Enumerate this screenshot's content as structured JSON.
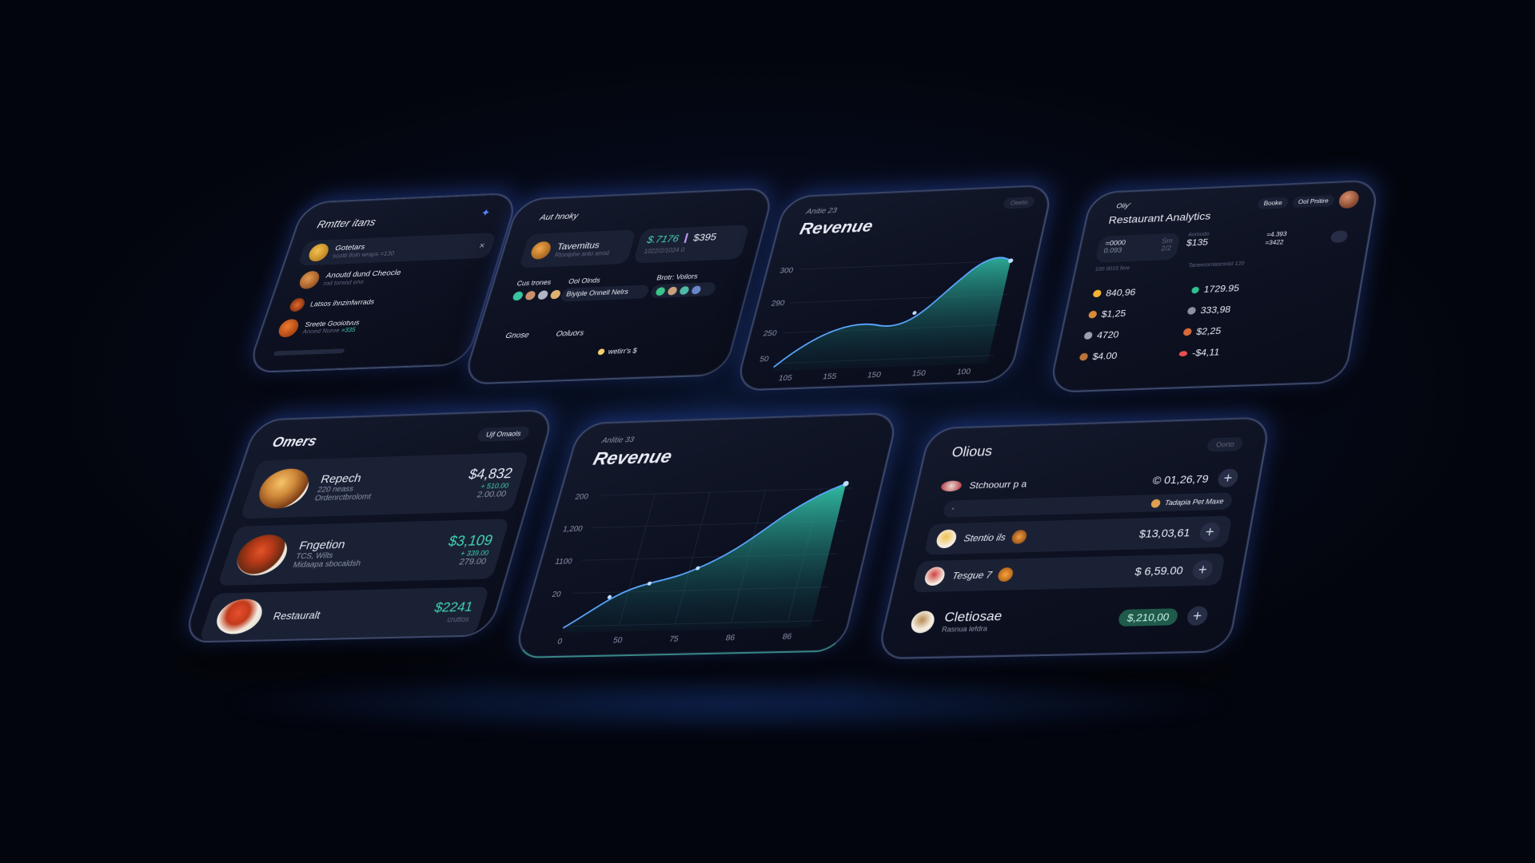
{
  "card1": {
    "title": "Rmtter itans",
    "items": [
      {
        "name": "Gotetars",
        "sub": "scotti ifolo wraps =130"
      },
      {
        "name": "Anoutd dund Cheocle",
        "sub": "rod torsod eno"
      },
      {
        "name": "Latsos ihnzinfwrrads",
        "sub": ""
      },
      {
        "name": "Sreete Gooiotvus",
        "sub": "Anoed Nuroe",
        "price": "=335"
      }
    ],
    "close_glyph": "×"
  },
  "card2": {
    "header": "Aut hnoky",
    "item_name": "Tavemitus",
    "item_sub": "Rtoniphe anlo anod",
    "amount_teal": "$.7176",
    "amount_white": "$395",
    "amount_sub": "1022/2/1024 0",
    "section1": "Cus trones",
    "section2": "Ool Olnds",
    "section2_sub": "Biyiple Onnell Nelrs",
    "section3": "Brotr: Voilors",
    "footer_left": "Gnose",
    "footer_mid": "Ooluors",
    "footer_right": "wetirr's $"
  },
  "card3": {
    "header": "Anitie 23",
    "title": "Revenue",
    "badge": "Oeeto",
    "y_ticks": [
      "300",
      "290",
      "250",
      "50"
    ],
    "x_ticks": [
      "105",
      "155",
      "150",
      "150",
      "100"
    ]
  },
  "card4": {
    "brand": "Oiiy'",
    "title": "Restaurant Analytics",
    "tab1": "Booke",
    "tab2": "Ool Pnitire",
    "stat_left_top": "=0000",
    "stat_left_sub": "0.093",
    "stat_left_tag": "Sm",
    "stat_left_tag2": "2/2",
    "stat_mid_label": "Anmodo",
    "stat_mid": "$135",
    "stat_right_top": "=4.393",
    "stat_right": "=3422",
    "caption_left": "100 0015 fere",
    "caption_right": "Taneerorriasmnisl 120",
    "left_values": [
      "840,96",
      "$1,25",
      "4720",
      "$4.00"
    ],
    "right_values": [
      "1729.95",
      "333,98",
      "$2,25",
      "-$4,11"
    ]
  },
  "card5": {
    "title": "Omers",
    "badge": "Ujf Omaols",
    "items": [
      {
        "name": "Repech",
        "sub1": "220 neass",
        "sub2": "Ordenrctbrolomt",
        "price": "$4,832",
        "delta": "+ 510.00",
        "change": "2.00.00"
      },
      {
        "name": "Fngetion",
        "sub1": "TCS, Wilts",
        "sub2": "Midaapa sbocaldsh",
        "price": "$3,109",
        "delta": "+ 339.00",
        "change": "279.00"
      },
      {
        "name": "Restauralt",
        "sub1": "cruttos",
        "sub2": "",
        "price": "$2241",
        "delta": "",
        "change": ""
      }
    ]
  },
  "card6": {
    "header": "Anlitie 33",
    "title": "Revenue",
    "y_ticks": [
      "200",
      "1,200",
      "1100",
      "20",
      "0"
    ],
    "x_ticks": [
      "0",
      "50",
      "75",
      "86",
      "86"
    ]
  },
  "card7": {
    "title": "Olious",
    "badge": "Oorto",
    "rows": [
      {
        "name": "Stchoourr p a",
        "price": "© 01,26,79"
      },
      {
        "name": "Stentio ils",
        "price": "$13,03,61"
      },
      {
        "name": "Tesgue 7",
        "price": "$ 6,59.00"
      }
    ],
    "subrow": "Tadapia Pet Maxe",
    "footer_name": "Cletiosae",
    "footer_sub": "Rasnua lefdra",
    "footer_price": "$,210,00"
  },
  "colors": {
    "accent_teal": "#3fd3b2",
    "accent_blue": "#3b6bff",
    "line_blue": "#5aa6ff"
  }
}
